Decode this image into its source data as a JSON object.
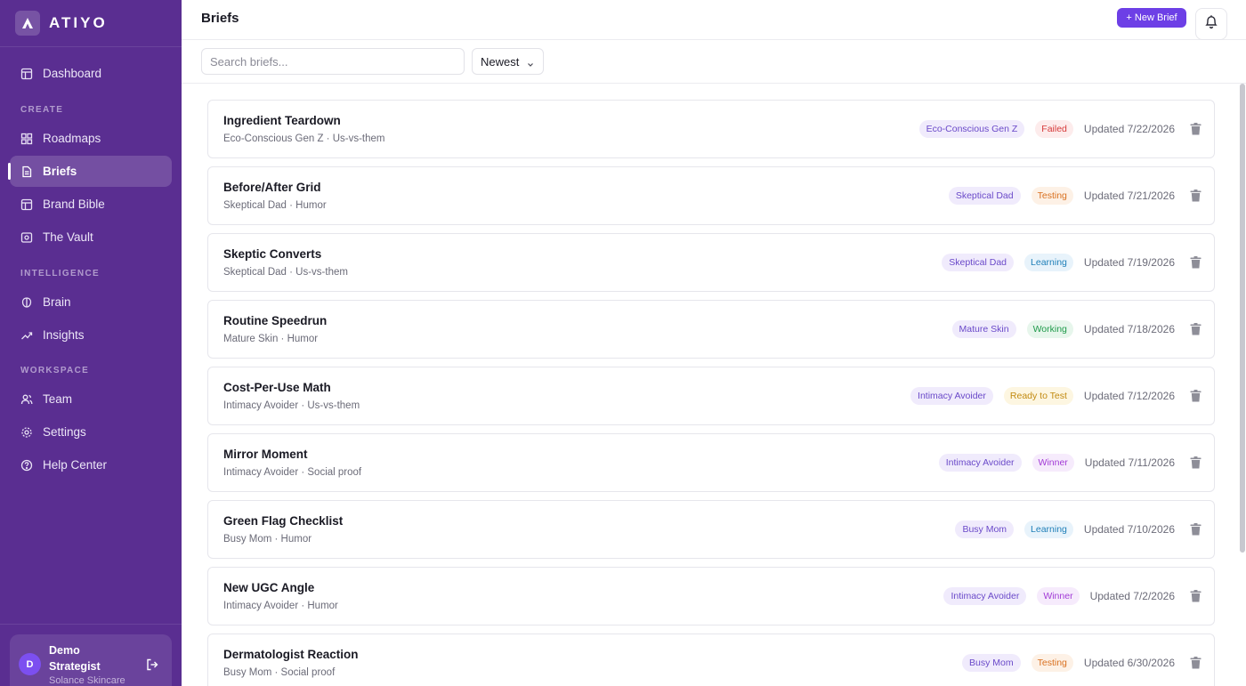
{
  "brand": {
    "name": "ATIYO"
  },
  "sidebar": {
    "items": [
      {
        "label": "Dashboard"
      },
      {
        "label": "Roadmaps"
      },
      {
        "label": "Briefs"
      },
      {
        "label": "Brand Bible"
      },
      {
        "label": "The Vault"
      },
      {
        "label": "Brain"
      },
      {
        "label": "Insights"
      },
      {
        "label": "Team"
      },
      {
        "label": "Settings"
      },
      {
        "label": "Help Center"
      }
    ],
    "sections": {
      "create": "CREATE",
      "intelligence": "INTELLIGENCE",
      "workspace": "WORKSPACE"
    },
    "active": "Briefs"
  },
  "user": {
    "initial": "D",
    "name": "Demo Strategist",
    "org": "Solance Skincare"
  },
  "header": {
    "title": "Briefs",
    "new_label": "+ New Brief"
  },
  "toolbar": {
    "search_placeholder": "Search briefs...",
    "sort_value": "Newest"
  },
  "colors": {
    "sidebar": "#5a2e91",
    "accent": "#6d3fe6"
  },
  "briefs": [
    {
      "title": "Ingredient Teardown",
      "sub": "Eco-Conscious Gen Z · Us-vs-them",
      "audience": "Eco-Conscious Gen Z",
      "status": "Failed",
      "updated": "Updated 7/22/2026"
    },
    {
      "title": "Before/After Grid",
      "sub": "Skeptical Dad · Humor",
      "audience": "Skeptical Dad",
      "status": "Testing",
      "updated": "Updated 7/21/2026"
    },
    {
      "title": "Skeptic Converts",
      "sub": "Skeptical Dad · Us-vs-them",
      "audience": "Skeptical Dad",
      "status": "Learning",
      "updated": "Updated 7/19/2026"
    },
    {
      "title": "Routine Speedrun",
      "sub": "Mature Skin · Humor",
      "audience": "Mature Skin",
      "status": "Working",
      "updated": "Updated 7/18/2026"
    },
    {
      "title": "Cost-Per-Use Math",
      "sub": "Intimacy Avoider · Us-vs-them",
      "audience": "Intimacy Avoider",
      "status": "Ready to Test",
      "updated": "Updated 7/12/2026"
    },
    {
      "title": "Mirror Moment",
      "sub": "Intimacy Avoider · Social proof",
      "audience": "Intimacy Avoider",
      "status": "Winner",
      "updated": "Updated 7/11/2026"
    },
    {
      "title": "Green Flag Checklist",
      "sub": "Busy Mom · Humor",
      "audience": "Busy Mom",
      "status": "Learning",
      "updated": "Updated 7/10/2026"
    },
    {
      "title": "New UGC Angle",
      "sub": "Intimacy Avoider · Humor",
      "audience": "Intimacy Avoider",
      "status": "Winner",
      "updated": "Updated 7/2/2026"
    },
    {
      "title": "Dermatologist Reaction",
      "sub": "Busy Mom · Social proof",
      "audience": "Busy Mom",
      "status": "Testing",
      "updated": "Updated 6/30/2026"
    }
  ],
  "status_colors": {
    "Failed": {
      "fg": "#d63a3a",
      "bg": "#fdecec"
    },
    "Testing": {
      "fg": "#d9701f",
      "bg": "#fdf1e6"
    },
    "Learning": {
      "fg": "#1f7fb8",
      "bg": "#e8f3fb"
    },
    "Working": {
      "fg": "#1f9a4a",
      "bg": "#e7f6ec"
    },
    "Ready to Test": {
      "fg": "#c28a10",
      "bg": "#fdf6e1"
    },
    "Winner": {
      "fg": "#a23bd6",
      "bg": "#f6ebfc"
    }
  }
}
